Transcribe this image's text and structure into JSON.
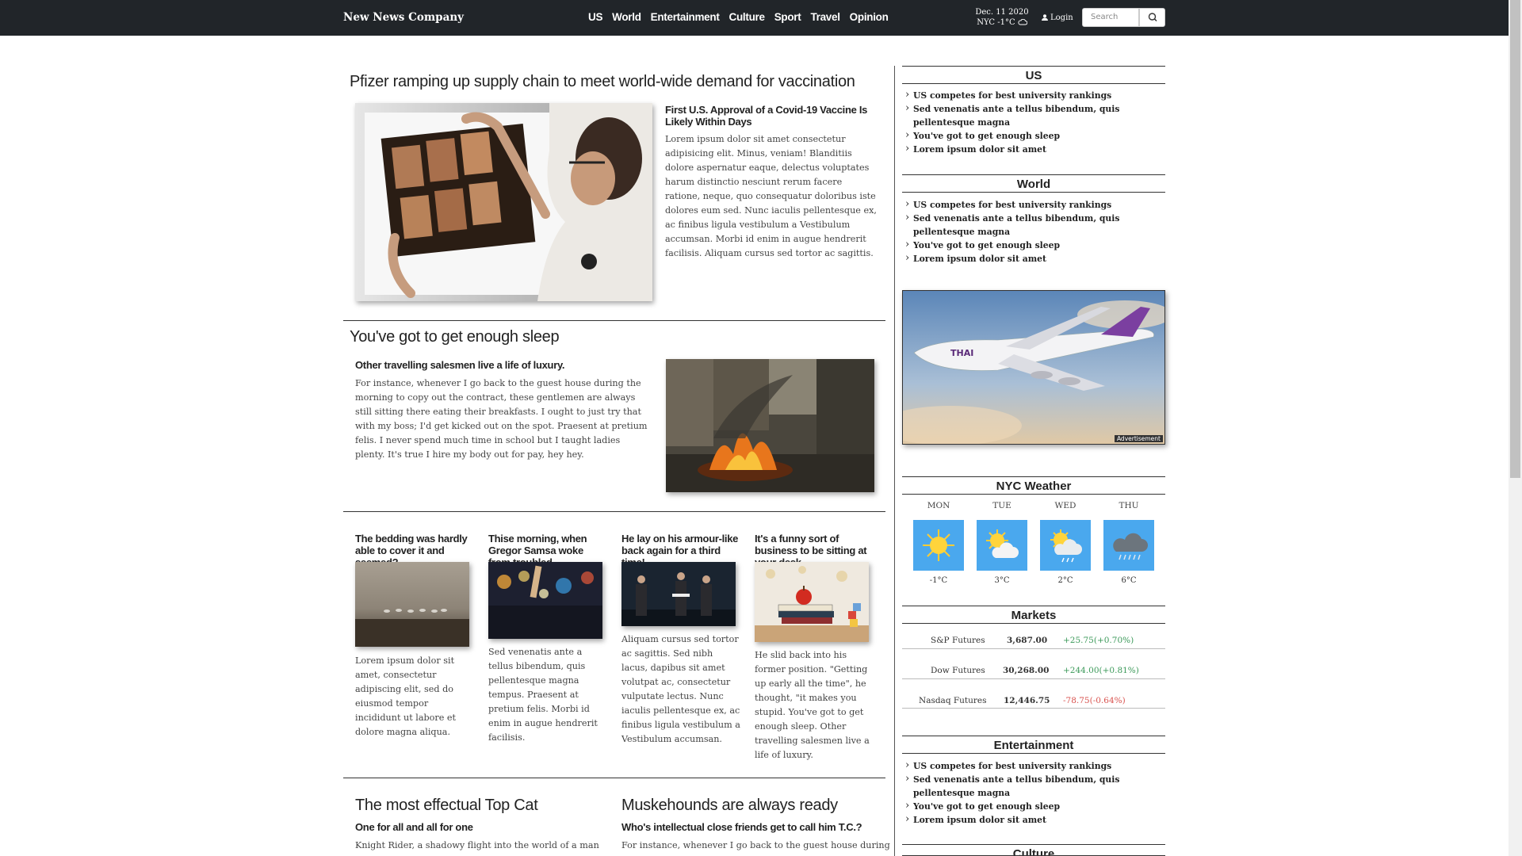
{
  "brand": "New News Company",
  "nav": [
    "US",
    "World",
    "Entertainment",
    "Culture",
    "Sport",
    "Travel",
    "Opinion"
  ],
  "date": "Dec. 11 2020",
  "city_weather": "NYC -1°C",
  "login": "Login",
  "search_placeholder": "Search",
  "feature": {
    "headline": "Pfizer ramping up supply chain to meet world-wide demand for vaccination",
    "subhead": "First U.S. Approval of a Covid-19 Vaccine Is Likely Within Days",
    "body": "Lorem ipsum dolor sit amet consectetur adipisicing elit. Minus, veniam! Blanditiis dolore aspernatur eaque, delectus voluptates harum distinctio nesciunt rerum facere ratione, neque, quo consequatur doloribus iste dolores eum sed. Nunc iaculis pellentesque ex, ac finibus ligula vestibulum a Vestibulum accumsan. Morbi id enim in augue hendrerit facilisis. Aliquam cursus sed tortor ac sagittis."
  },
  "second": {
    "headline": "You've got to get enough sleep",
    "subhead": "Other travelling salesmen live a life of luxury.",
    "body": "For instance, whenever I go back to the guest house during the morning to copy out the contract, these gentlemen are always still sitting there eating their breakfasts. I ought to just try that with my boss; I'd get kicked out on the spot. Praesent at pretium felis. I never spend much time in school but I taught ladies plenty. It's true I hire my body out for pay, hey hey."
  },
  "cards": [
    {
      "title": "The bedding was hardly able to cover it and seemed?",
      "body": "Lorem ipsum dolor sit amet, consectetur adipiscing elit, sed do eiusmod tempor incididunt ut labore et dolore magna aliqua."
    },
    {
      "title": "Thise morning, when Gregor Samsa woke from troubled",
      "body": "Sed venenatis ante a tellus bibendum, quis pellentesque magna tempus. Praesent at pretium felis. Morbi id enim in augue hendrerit facilisis."
    },
    {
      "title": "He lay on his armour-like back again for a third time!",
      "body": "Aliquam cursus sed tortor ac sagittis. Sed nibh lacus, dapibus sit amet volutpat ac, consectetur vulputate lectus. Nunc iaculis pellentesque ex, ac finibus ligula vestibulum a Vestibulum accumsan."
    },
    {
      "title": "It's a funny sort of business to be sitting at your desk",
      "body": "He slid back into his former position. \"Getting up early all the time\", he thought, \"it makes you stupid. You've got to get enough sleep. Other travelling salesmen live a life of luxury."
    }
  ],
  "bottom": [
    {
      "headline": "The most effectual Top Cat",
      "subhead": "One for all and all for one",
      "body": "Knight Rider, a shadowy flight into the world of a man"
    },
    {
      "headline": "Muskehounds are always ready",
      "subhead": "Who's intellectual close friends get to call him T.C.?",
      "body": "For instance, whenever I go back to the guest house during"
    }
  ],
  "sidebar": {
    "us": {
      "title": "US",
      "items": [
        "US competes for best university rankings",
        "Sed venenatis ante a tellus bibendum, quis pellentesque magna",
        "You've got to get enough sleep",
        "Lorem ipsum dolor sit amet"
      ]
    },
    "world": {
      "title": "World",
      "items": [
        "US competes for best university rankings",
        "Sed venenatis ante a tellus bibendum, quis pellentesque magna",
        "You've got to get enough sleep",
        "Lorem ipsum dolor sit amet"
      ]
    },
    "ad_label": "Advertisement",
    "weather": {
      "title": "NYC Weather",
      "days": [
        {
          "day": "MON",
          "temp": "-1°C",
          "icon": "sun-icon"
        },
        {
          "day": "TUE",
          "temp": "3°C",
          "icon": "partly-cloudy-icon"
        },
        {
          "day": "WED",
          "temp": "2°C",
          "icon": "sun-shower-icon"
        },
        {
          "day": "THU",
          "temp": "6°C",
          "icon": "rain-cloud-icon"
        }
      ]
    },
    "markets": {
      "title": "Markets",
      "rows": [
        {
          "name": "S&P Futures",
          "value": "3,687.00",
          "change": "+25.75(+0.70%)",
          "color": "#3c9a5a"
        },
        {
          "name": "Dow Futures",
          "value": "30,268.00",
          "change": "+244.00(+0.81%)",
          "color": "#3c9a5a"
        },
        {
          "name": "Nasdaq Futures",
          "value": "12,446.75",
          "change": "-78.75(-0.64%)",
          "color": "#d9534f"
        }
      ]
    },
    "entertainment": {
      "title": "Entertainment",
      "items": [
        "US competes for best university rankings",
        "Sed venenatis ante a tellus bibendum, quis pellentesque magna",
        "You've got to get enough sleep",
        "Lorem ipsum dolor sit amet"
      ]
    },
    "culture": {
      "title": "Culture"
    }
  }
}
